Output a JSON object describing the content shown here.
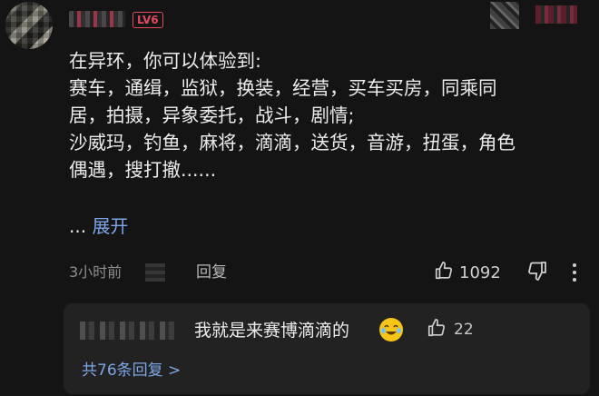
{
  "comment": {
    "level_badge": "LV6",
    "lines": [
      "在异环，你可以体验到:",
      "赛车，通缉，监狱，换装，经营，买车买房，同乘同",
      "居，拍摄，异象委托，战斗，剧情;",
      "沙威玛，钓鱼，麻将，滴滴，送货，音游，扭蛋，角色",
      "偶遇，搜打撤......"
    ],
    "ellipsis": "...",
    "expand_label": "展开",
    "time": "3小时前",
    "reply_label": "回复",
    "like_count": "1092"
  },
  "reply": {
    "text": "我就是来赛博滴滴的",
    "like_count": "22",
    "view_replies": "共76条回复 >"
  },
  "icons": {
    "like": "thumbs-up-icon",
    "dislike": "thumbs-down-icon",
    "more": "more-vertical-icon",
    "emoji": "laughing-crying-emoji"
  },
  "colors": {
    "background": "#141414",
    "link": "#7da6e6",
    "level_badge": "#e24a5e",
    "reply_box": "#222222"
  }
}
